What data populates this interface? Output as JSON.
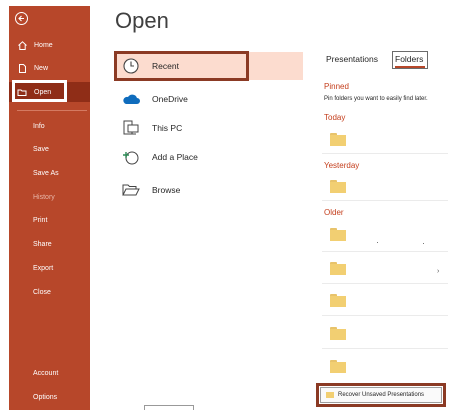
{
  "sidebar": {
    "items": [
      {
        "label": "Home",
        "icon": "home-icon"
      },
      {
        "label": "New",
        "icon": "new-document-icon"
      },
      {
        "label": "Open",
        "icon": "open-folder-icon"
      },
      {
        "label": "Info"
      },
      {
        "label": "Save"
      },
      {
        "label": "Save As"
      },
      {
        "label": "History"
      },
      {
        "label": "Print"
      },
      {
        "label": "Share"
      },
      {
        "label": "Export"
      },
      {
        "label": "Close"
      },
      {
        "label": "Account"
      },
      {
        "label": "Options"
      }
    ]
  },
  "page": {
    "title": "Open"
  },
  "locations": [
    {
      "label": "Recent",
      "icon": "clock-icon"
    },
    {
      "label": "OneDrive",
      "icon": "cloud-icon"
    },
    {
      "label": "This PC",
      "icon": "computer-icon"
    },
    {
      "label": "Add a Place",
      "icon": "add-place-icon"
    },
    {
      "label": "Browse",
      "icon": "folder-open-icon"
    }
  ],
  "tabs": {
    "presentations": "Presentations",
    "folders": "Folders"
  },
  "sections": {
    "pinned": "Pinned",
    "pinned_hint": "Pin folders you want to easily find later.",
    "today": "Today",
    "yesterday": "Yesterday",
    "older": "Older"
  },
  "recover_button": "Recover Unsaved Presentations",
  "colors": {
    "accent": "#b7472a",
    "accent_dark": "#8f2d17",
    "selected_bg": "#fcdccf",
    "highlight_border": "#8b3a24"
  }
}
